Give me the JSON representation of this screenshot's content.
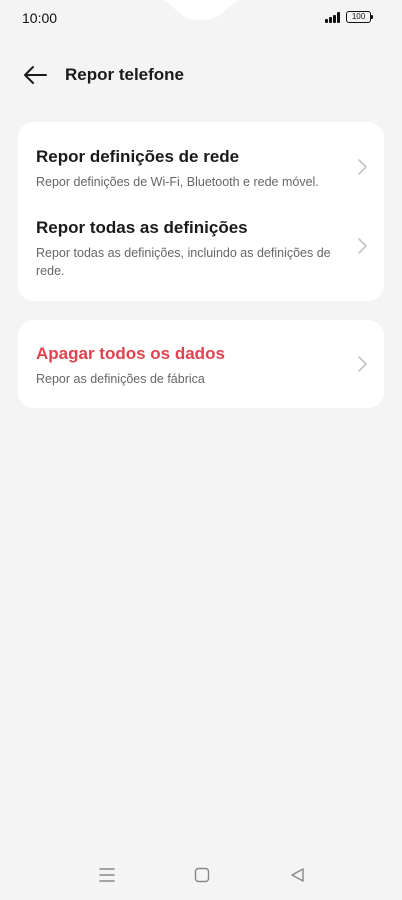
{
  "status_bar": {
    "time": "10:00",
    "battery": "100"
  },
  "header": {
    "title": "Repor telefone",
    "back_icon": "arrow-left-icon"
  },
  "groups": [
    {
      "items": [
        {
          "title": "Repor definições de rede",
          "subtitle": "Repor definições de Wi-Fi, Bluetooth e rede móvel."
        },
        {
          "title": "Repor todas as definições",
          "subtitle": "Repor todas as definições, incluindo as definições de rede."
        }
      ]
    },
    {
      "items": [
        {
          "title": "Apagar todos os dados",
          "subtitle": "Repor as definições de fábrica",
          "color": "#e0424f"
        }
      ]
    }
  ],
  "nav_bar": {
    "buttons": [
      "menu-icon",
      "home-icon",
      "back-triangle-icon"
    ]
  },
  "colors": {
    "background": "#f4f4f4",
    "card": "#ffffff",
    "danger": "#e0424f",
    "secondary_text": "#666666"
  }
}
